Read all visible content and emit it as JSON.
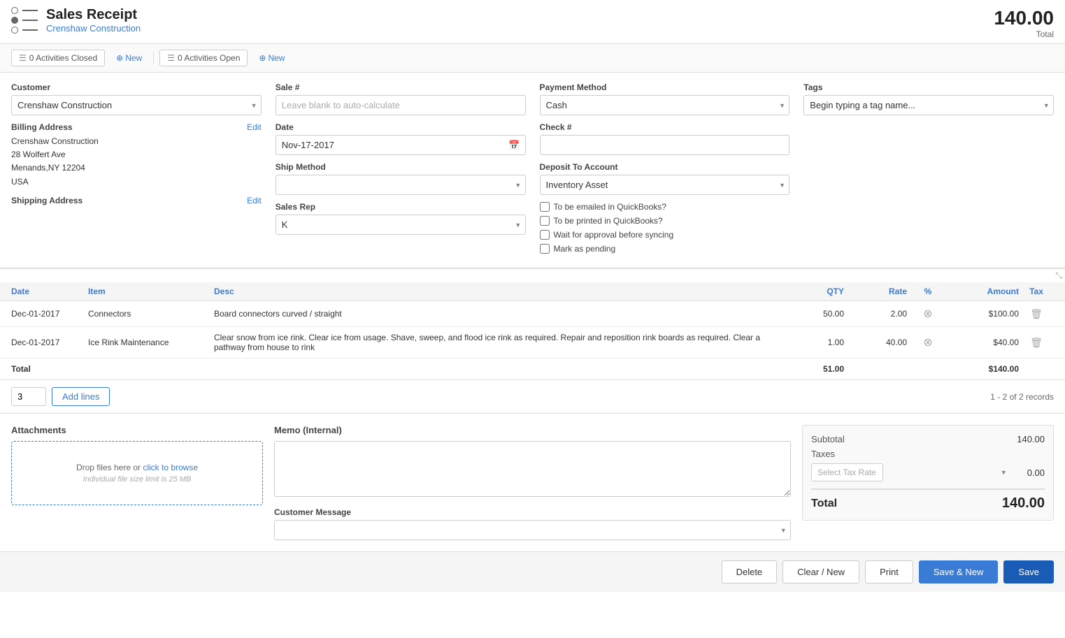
{
  "header": {
    "title": "Sales Receipt",
    "company_name": "Crenshaw  Construction",
    "total_amount": "140.00",
    "total_label": "Total"
  },
  "activities": {
    "closed_count": "0 Activities Closed",
    "closed_new": "New",
    "open_count": "0 Activities Open",
    "open_new": "New"
  },
  "form": {
    "customer_label": "Customer",
    "customer_value": "Crenshaw Construction",
    "sale_label": "Sale #",
    "sale_placeholder": "Leave blank to auto-calculate",
    "payment_method_label": "Payment Method",
    "payment_method_value": "Cash",
    "tags_label": "Tags",
    "tags_placeholder": "Begin typing a tag name...",
    "billing_address_label": "Billing Address",
    "billing_edit": "Edit",
    "billing_line1": "Crenshaw Construction",
    "billing_line2": "28 Wolfert Ave",
    "billing_line3": "Menands,NY 12204",
    "billing_line4": "USA",
    "shipping_address_label": "Shipping Address",
    "shipping_edit": "Edit",
    "date_label": "Date",
    "date_value": "Nov-17-2017",
    "check_label": "Check #",
    "check_value": "",
    "ship_method_label": "Ship Method",
    "ship_method_value": "",
    "deposit_account_label": "Deposit To Account",
    "deposit_account_value": "Inventory Asset",
    "sales_rep_label": "Sales Rep",
    "sales_rep_value": "K",
    "checkbox_email": "To be emailed in QuickBooks?",
    "checkbox_print": "To be printed in QuickBooks?",
    "checkbox_approval": "Wait for approval before syncing",
    "checkbox_pending": "Mark as pending"
  },
  "table": {
    "columns": {
      "date": "Date",
      "item": "Item",
      "desc": "Desc",
      "qty": "QTY",
      "rate": "Rate",
      "percent": "%",
      "amount": "Amount",
      "tax": "Tax"
    },
    "rows": [
      {
        "date": "Dec-01-2017",
        "item": "Connectors",
        "desc": "Board connectors curved / straight",
        "qty": "50.00",
        "rate": "2.00",
        "amount": "$100.00"
      },
      {
        "date": "Dec-01-2017",
        "item": "Ice Rink Maintenance",
        "desc": "Clear snow from ice rink. Clear ice from usage. Shave, sweep, and flood ice rink as required. Repair and reposition rink boards as required. Clear a pathway from house to rink",
        "qty": "1.00",
        "rate": "40.00",
        "amount": "$40.00"
      }
    ],
    "total_label": "Total",
    "total_qty": "51.00",
    "total_amount": "$140.00"
  },
  "add_lines": {
    "lines_value": "3",
    "button_label": "Add lines",
    "records_text": "1 - 2 of 2 records"
  },
  "attachments": {
    "title": "Attachments",
    "drop_text": "Drop files here or ",
    "browse_text": "click to browse",
    "limit_text": "Individual file size limit is 25 MB"
  },
  "memo": {
    "label": "Memo (Internal)",
    "customer_message_label": "Customer Message"
  },
  "totals": {
    "subtotal_label": "Subtotal",
    "subtotal_value": "140.00",
    "taxes_label": "Taxes",
    "tax_rate_placeholder": "Select Tax Rate",
    "tax_value": "0.00",
    "total_label": "Total",
    "total_value": "140.00"
  },
  "footer": {
    "delete_label": "Delete",
    "clear_label": "Clear / New",
    "print_label": "Print",
    "savenew_label": "Save & New",
    "save_label": "Save"
  }
}
